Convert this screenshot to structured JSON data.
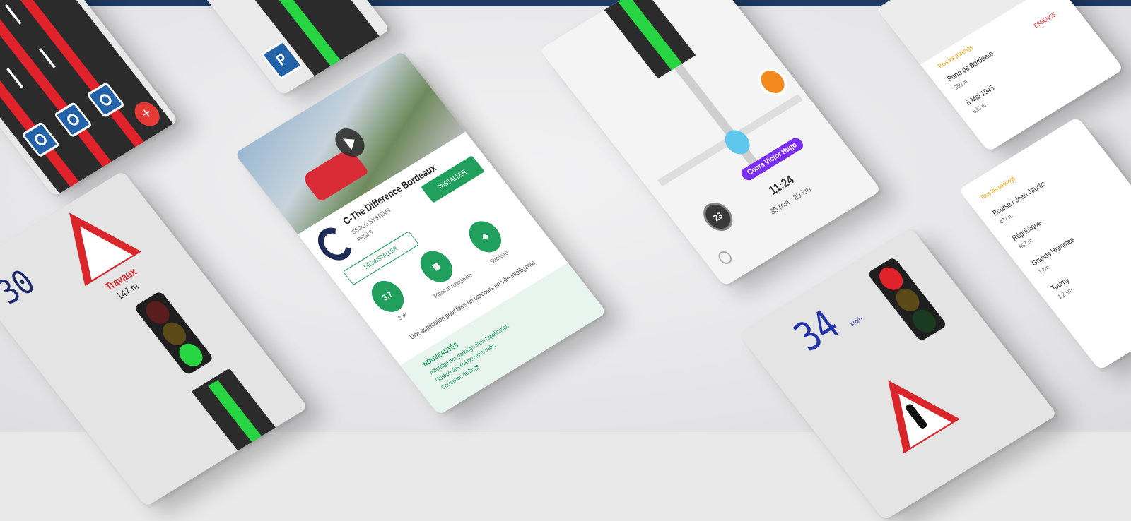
{
  "colors": {
    "top_bar": "#1d3a63",
    "road": "#2b2b2b",
    "lane_red": "#e0222a",
    "lane_green": "#27d441",
    "store_green": "#20a05c",
    "waze_purple": "#7b2ff2",
    "warning_red": "#d9262b"
  },
  "lanes_screen": {
    "fab_icon": "plus-icon"
  },
  "parking_screen": {
    "parking_icon": "parking-p-icon"
  },
  "store_screen": {
    "app_title": "C-The Difference Bordeaux",
    "developer": "SEGLIS SYSTEMS",
    "pegi": "PEGI 3",
    "install_label": "INSTALLER",
    "uninstall_label": "DÉSINSTALLER",
    "rating": "3,7",
    "rating_caption": "3 ★",
    "badge_category": "Plans et navigation",
    "badge_similar": "Similaire",
    "tagline": "Une application pour faire un parcours en ville intelligente",
    "whats_new_title": "NOUVEAUTÉS",
    "whats_new_lines": [
      "Affichage des parkings dans l'application",
      "Gestion des évènements trafic",
      "Correction de bugs"
    ]
  },
  "nav_screen": {
    "street_name": "Cours Victor Hugo",
    "arrival_time": "11:24",
    "trip_summary": "35 min · 29 km",
    "speed": "23"
  },
  "parking_list_top": {
    "header": "Tous les parkings",
    "items": [
      {
        "name": "Porte de Bordeaux",
        "distance": "350 m"
      },
      {
        "name": "8 Mai 1945",
        "distance": "530 m"
      }
    ],
    "side_label": "ESSENCE"
  },
  "parking_list_right": {
    "header": "Tous les parkings",
    "items": [
      {
        "name": "Bourse / Jean Jaurès",
        "distance": "477 m"
      },
      {
        "name": "République",
        "distance": "697 m"
      },
      {
        "name": "Grands Hommes",
        "distance": "1 km"
      },
      {
        "name": "Tourny",
        "distance": "1,2 km"
      }
    ]
  },
  "works_screen": {
    "speed": "30",
    "warning_label": "Travaux",
    "warning_distance": "147 m"
  },
  "speed_screen": {
    "speed": "34",
    "unit": "km/h"
  }
}
